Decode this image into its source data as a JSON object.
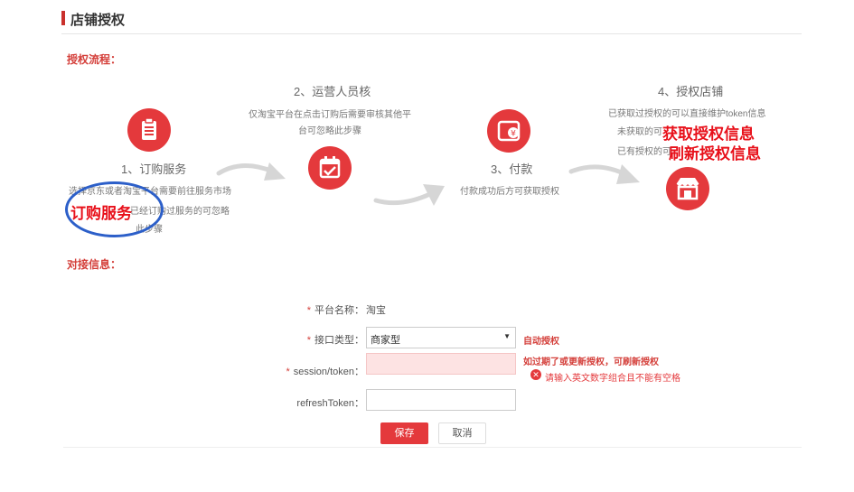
{
  "page": {
    "title": "店铺授权"
  },
  "flow": {
    "label": "授权流程：",
    "steps": [
      {
        "title": "1、订购服务",
        "desc_lines": [
          "选择京东或者淘宝平台需要前往服务市场",
          "已经订购过服务的可忽略",
          "此步骤"
        ]
      },
      {
        "title": "2、运营人员核",
        "desc_lines": [
          "仅淘宝平台在点击订购后需要审核其他平",
          "台可忽略此步骤"
        ]
      },
      {
        "title": "3、付款",
        "desc_lines": [
          "付款成功后方可获取授权"
        ]
      },
      {
        "title": "4、授权店铺",
        "desc_lines": [
          "已获取过授权的可以直接维护token信息",
          "未获取的可",
          "已有授权的可"
        ]
      }
    ],
    "annotations": {
      "subscribe": "订购服务",
      "get_auth": "获取授权信息",
      "refresh_auth": "刷新授权信息"
    }
  },
  "connect": {
    "label": "对接信息：",
    "platform": {
      "label": "平台名称：",
      "value": "淘宝"
    },
    "api_type": {
      "label": "接口类型：",
      "value": "商家型",
      "hint": "自动授权"
    },
    "session_token": {
      "label": "session/token：",
      "value": "",
      "hint": "如过期了或更新授权，可刷新授权",
      "error": "请输入英文数字组合且不能有空格"
    },
    "refresh_token": {
      "label": "refreshToken：",
      "value": ""
    },
    "save_label": "保存",
    "cancel_label": "取消"
  },
  "colors": {
    "accent": "#e4393c",
    "annotation": "#e8101a",
    "ellipse": "#2c5fc9"
  },
  "icons": [
    "clipboard-icon",
    "calendar-check-icon",
    "wallet-yen-icon",
    "store-icon",
    "curved-arrow-icon",
    "error-circle-icon",
    "caret-down-icon"
  ]
}
